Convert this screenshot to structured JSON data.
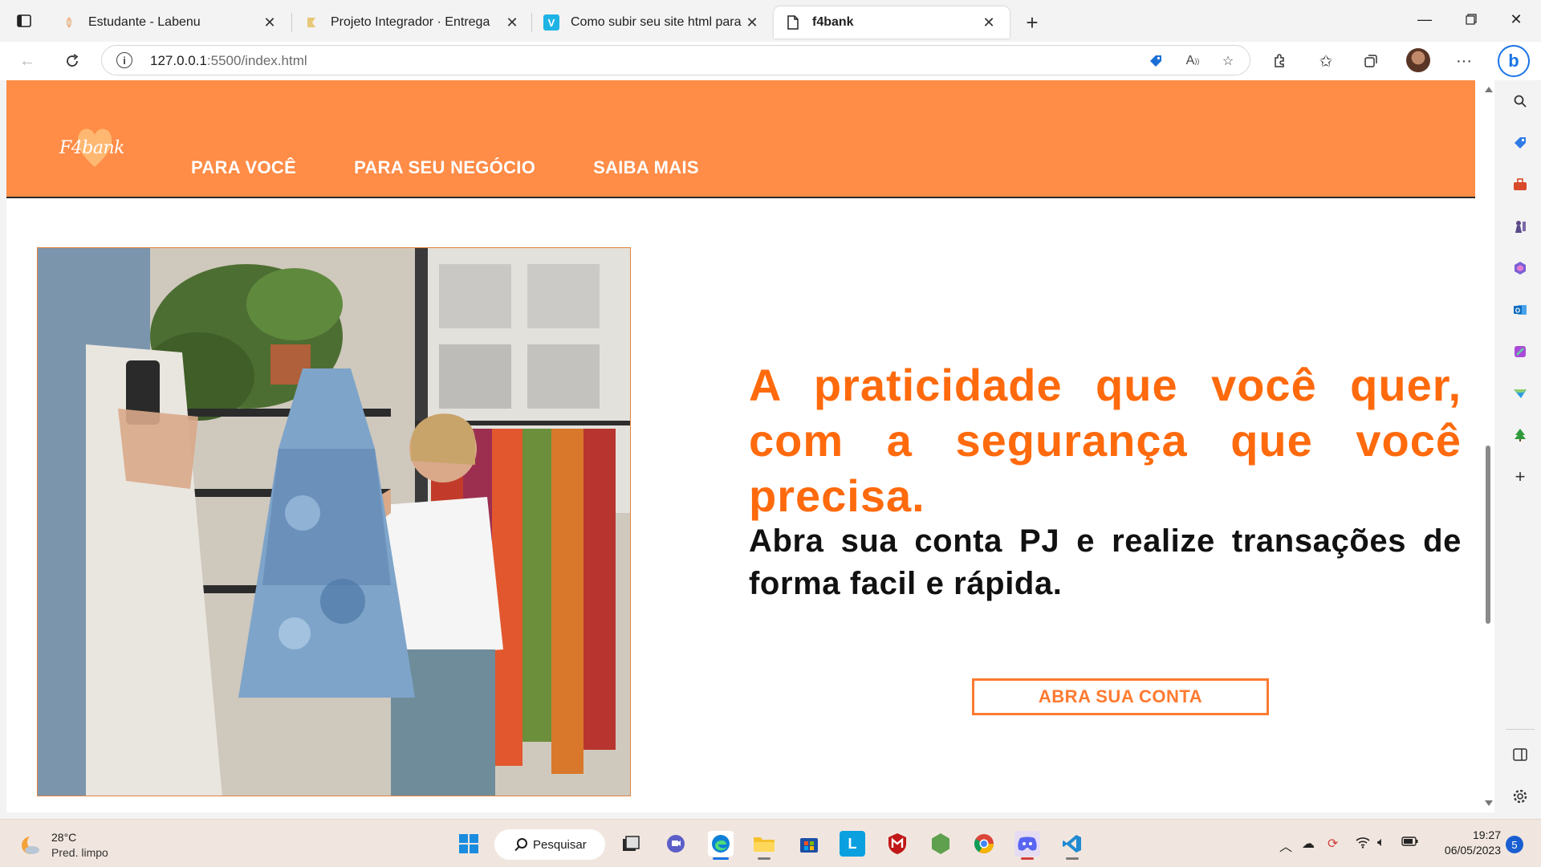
{
  "browser": {
    "tabs": [
      {
        "title": "Estudante - Labenu",
        "icon": "labenu-icon"
      },
      {
        "title": "Projeto Integrador · Entrega",
        "icon": "project-icon"
      },
      {
        "title": "Como subir seu site html para a",
        "icon": "v-icon"
      },
      {
        "title": "f4bank",
        "icon": "page-icon"
      }
    ],
    "new_tab_label": "+",
    "address": {
      "host": "127.0.0.1",
      "path": ":5500/index.html"
    }
  },
  "site": {
    "logo_text": "F4bank",
    "nav": [
      "PARA VOCÊ",
      "PARA SEU NEGÓCIO",
      "SAIBA MAIS"
    ],
    "hero": {
      "title": "A praticidade que você quer, com a segurança que você precisa.",
      "subtitle": "Abra sua conta PJ e realize transações de forma facil e rápida.",
      "cta": "ABRA SUA CONTA"
    },
    "colors": {
      "header": "#ff8c47",
      "accent": "#ff6a0d",
      "text": "#111111"
    }
  },
  "taskbar": {
    "weather_temp": "28°C",
    "weather_desc": "Pred. limpo",
    "search_label": "Pesquisar",
    "time": "19:27",
    "date": "06/05/2023",
    "notifications": "5"
  }
}
